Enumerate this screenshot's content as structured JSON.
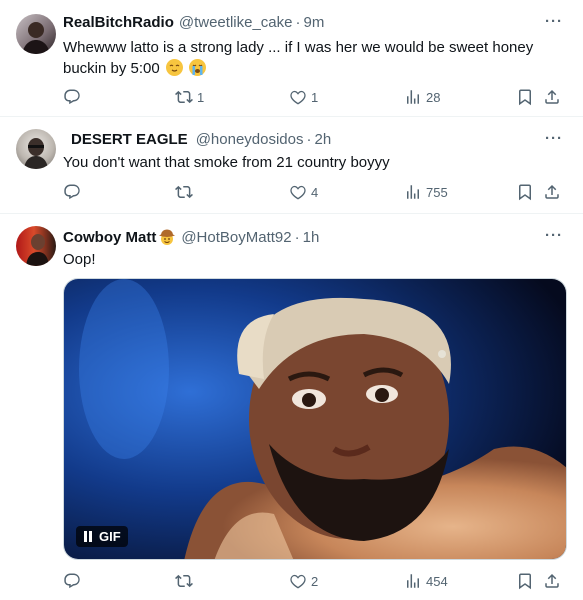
{
  "tweets": [
    {
      "name": "RealBitchRadio",
      "handle": "@tweetlike_cake",
      "dot": "·",
      "time": "9m",
      "text": "Whewww latto is a strong lady ... if I was her we would be sweet honey buckin by 5:00",
      "emojis": [
        "relieved-face",
        "crying-face"
      ],
      "replies": "",
      "retweets": "1",
      "likes": "1",
      "views": "28",
      "more": "···"
    },
    {
      "name": "DESERT EAGLE",
      "handle": "@honeydosidos",
      "dot": "·",
      "time": "2h",
      "text": "You don't want that smoke from 21 country boyyy",
      "replies": "",
      "retweets": "",
      "likes": "4",
      "views": "755",
      "more": "···"
    },
    {
      "name": "Cowboy Matt",
      "name_emoji": "cowboy-hat-face",
      "handle": "@HotBoyMatt92",
      "dot": "·",
      "time": "1h",
      "text": "Oop!",
      "media_badge": "GIF",
      "replies": "",
      "retweets": "",
      "likes": "2",
      "views": "454",
      "more": "···"
    }
  ],
  "icons": {
    "reply": "reply-icon",
    "retweet": "retweet-icon",
    "like": "heart-icon",
    "views": "views-icon",
    "bookmark": "bookmark-icon",
    "share": "share-icon"
  },
  "colors": {
    "text": "#0f1419",
    "secondary": "#536471",
    "divider": "#eff3f4"
  }
}
